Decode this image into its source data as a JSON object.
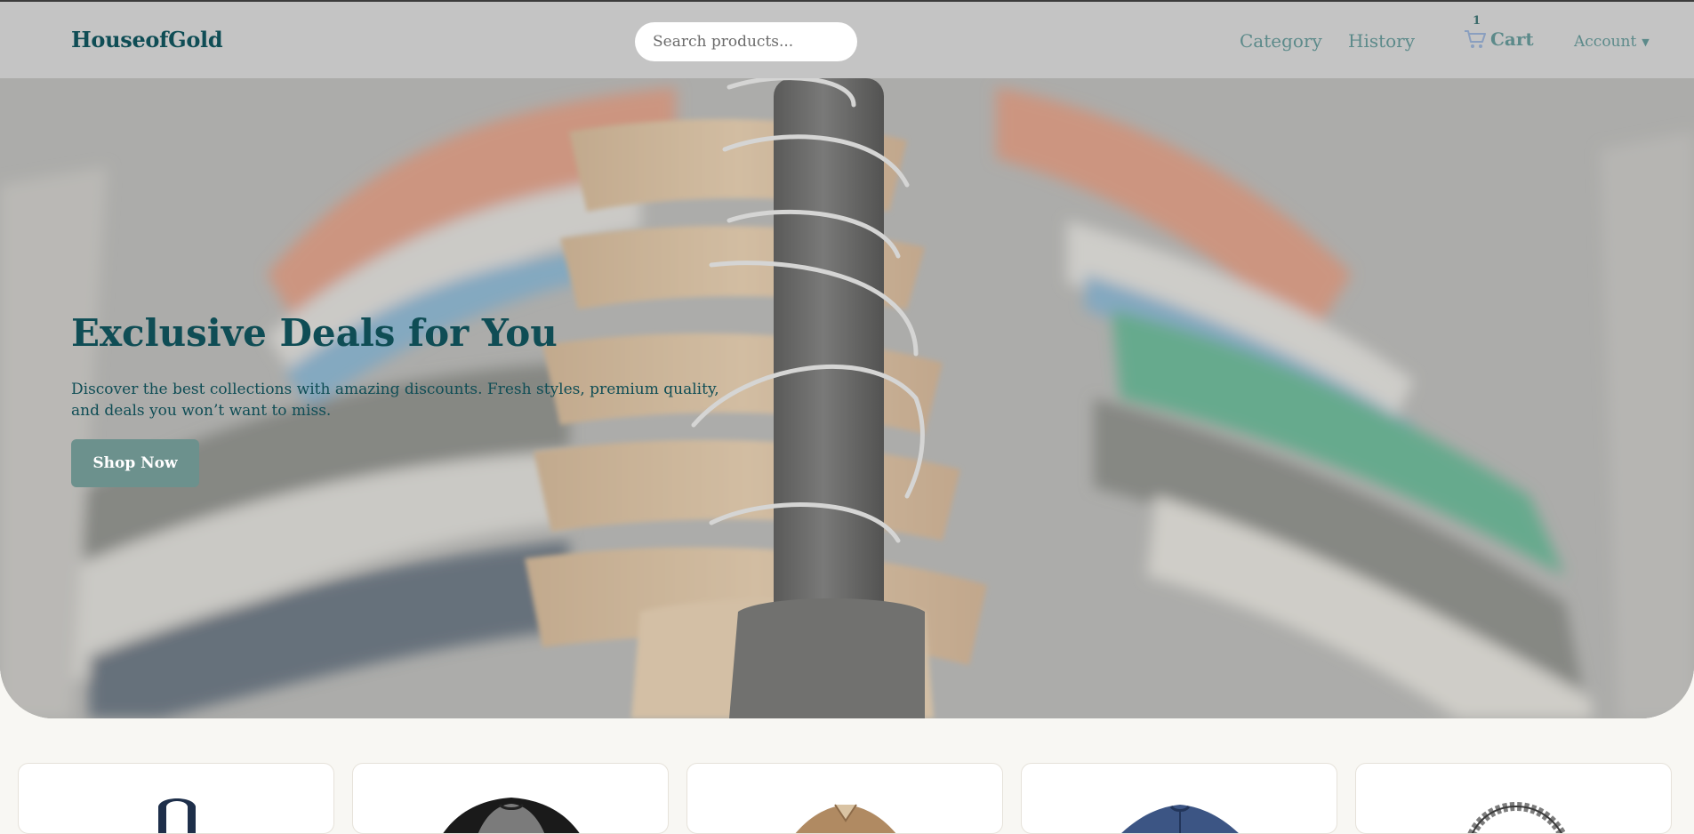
{
  "header": {
    "brand": "HouseofGold",
    "search_placeholder": "Search products...",
    "nav": {
      "category": "Category",
      "history": "History"
    },
    "cart": {
      "label": "Cart",
      "count": "1",
      "icon": "cart-icon"
    },
    "account": {
      "label": "Account",
      "caret": "▼"
    }
  },
  "hero": {
    "title": "Exclusive Deals for You",
    "subtitle": "Discover the best collections with amazing discounts. Fresh styles, premium quality, and deals you won’t want to miss.",
    "cta": "Shop Now"
  },
  "products": [
    {
      "icon": "tank-top-image"
    },
    {
      "icon": "raglan-tee-image"
    },
    {
      "icon": "brown-jacket-image"
    },
    {
      "icon": "navy-henley-image"
    },
    {
      "icon": "silver-bracelet-image"
    }
  ],
  "colors": {
    "brand": "#0f4d55",
    "nav": "#5c8a8a",
    "cta": "#6c918d",
    "header_bg": "#c4c4c4",
    "page_bg": "#f8f7f3"
  }
}
